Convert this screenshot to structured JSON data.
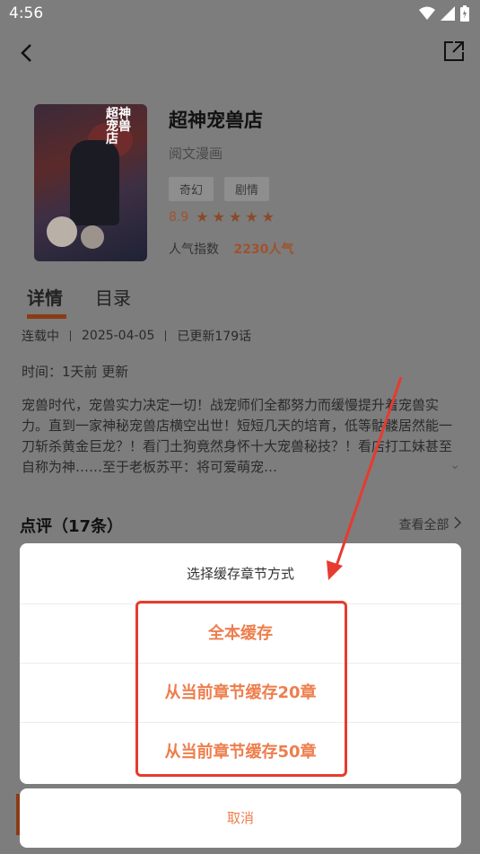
{
  "status_bar": {
    "time": "4:56",
    "icons": [
      "wifi-icon",
      "signal-icon",
      "battery-icon"
    ]
  },
  "header": {
    "back_icon": "chevron-left-icon",
    "share_icon": "share-icon"
  },
  "book": {
    "title": "超神宠兽店",
    "author": "阅文漫画",
    "tags": [
      "奇幻",
      "剧情"
    ],
    "score": "8.9",
    "stars": 5,
    "popularity_label": "人气指数",
    "popularity_value": "2230人气",
    "cover_title": "超神宠兽店"
  },
  "tabs": [
    "详情",
    "目录"
  ],
  "meta": {
    "status": "连载中",
    "date": "2025-04-05",
    "updated": "已更新179话"
  },
  "time_line": "时间：1天前 更新",
  "description": "宠兽时代，宠兽实力决定一切！战宠师们全都努力而缓慢提升着宠兽实力。直到一家神秘宠兽店横空出世！短短几天的培育，低等骷髅居然能一刀斩杀黄金巨龙？！看门土狗竟然身怀十大宠兽秘技？！看店打工妹甚至自称为神……至于老板苏平：将可爱萌宠…",
  "reviews": {
    "title": "点评（17条）",
    "view_all": "查看全部"
  },
  "dialog": {
    "title": "选择缓存章节方式",
    "options": [
      "全本缓存",
      "从当前章节缓存20章",
      "从当前章节缓存50章"
    ],
    "cancel": "取消"
  },
  "colors": {
    "accent": "#ee7e4d",
    "annotation_red": "#e63b2e"
  }
}
